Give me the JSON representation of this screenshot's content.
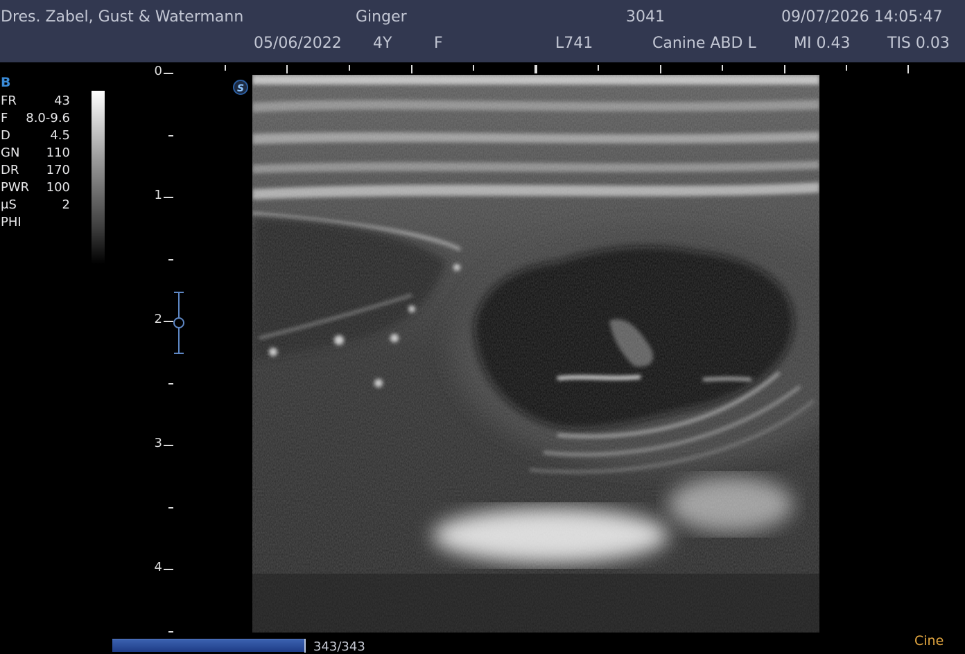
{
  "header": {
    "clinic": "Dres. Zabel, Gust & Watermann",
    "patient_name": "Ginger",
    "patient_id": "3041",
    "datetime": "09/07/2026 14:05:47",
    "birth_date": "05/06/2022",
    "age": "4Y",
    "sex": "F",
    "probe": "L741",
    "preset": "Canine ABD L",
    "mi": "MI 0.43",
    "tis": "TIS 0.03"
  },
  "mode": "B",
  "params": [
    {
      "label": "FR",
      "value": "43"
    },
    {
      "label": "F",
      "value": "8.0-9.6"
    },
    {
      "label": "D",
      "value": "4.5"
    },
    {
      "label": "GN",
      "value": "110"
    },
    {
      "label": "DR",
      "value": "170"
    },
    {
      "label": "PWR",
      "value": "100"
    },
    {
      "label": "μS",
      "value": "2"
    },
    {
      "label": "PHI",
      "value": ""
    }
  ],
  "depth_scale": [
    "0",
    "1",
    "2",
    "3",
    "4"
  ],
  "image_badge": "S",
  "cine": {
    "frame_counter": "343/343",
    "frame_fraction": 1.0,
    "label": "Cine"
  },
  "colors": {
    "header_bg": "#323850",
    "mode_accent": "#3a8ad6",
    "focus_marker": "#5e87c4",
    "cine_label": "#e2a640",
    "cine_bar": "#2a4ea0"
  }
}
